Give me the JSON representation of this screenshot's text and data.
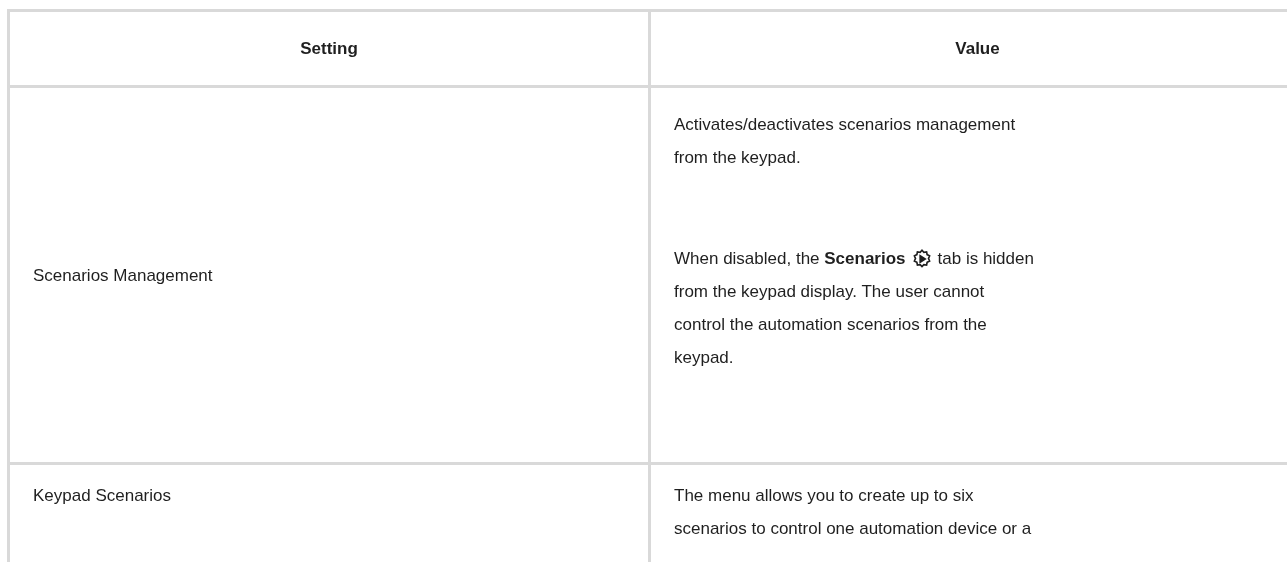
{
  "table": {
    "columns": [
      "Setting",
      "Value"
    ],
    "rows": [
      {
        "setting": "Scenarios Management",
        "paragraphs": [
          {
            "text": "Activates/deactivates scenarios management from the keypad."
          },
          {
            "kind": "icon_line",
            "text": "When disabled, the **Scenarios**",
            "text_after": "tab is hidden",
            "continuation": "from the keypad display. The user cannot control the automation scenarios from the keypad."
          }
        ]
      },
      {
        "setting": "Keypad Scenarios",
        "paragraphs": [
          {
            "text": "The menu allows you to create up to six scenarios to control one automation device or a"
          }
        ]
      }
    ]
  }
}
